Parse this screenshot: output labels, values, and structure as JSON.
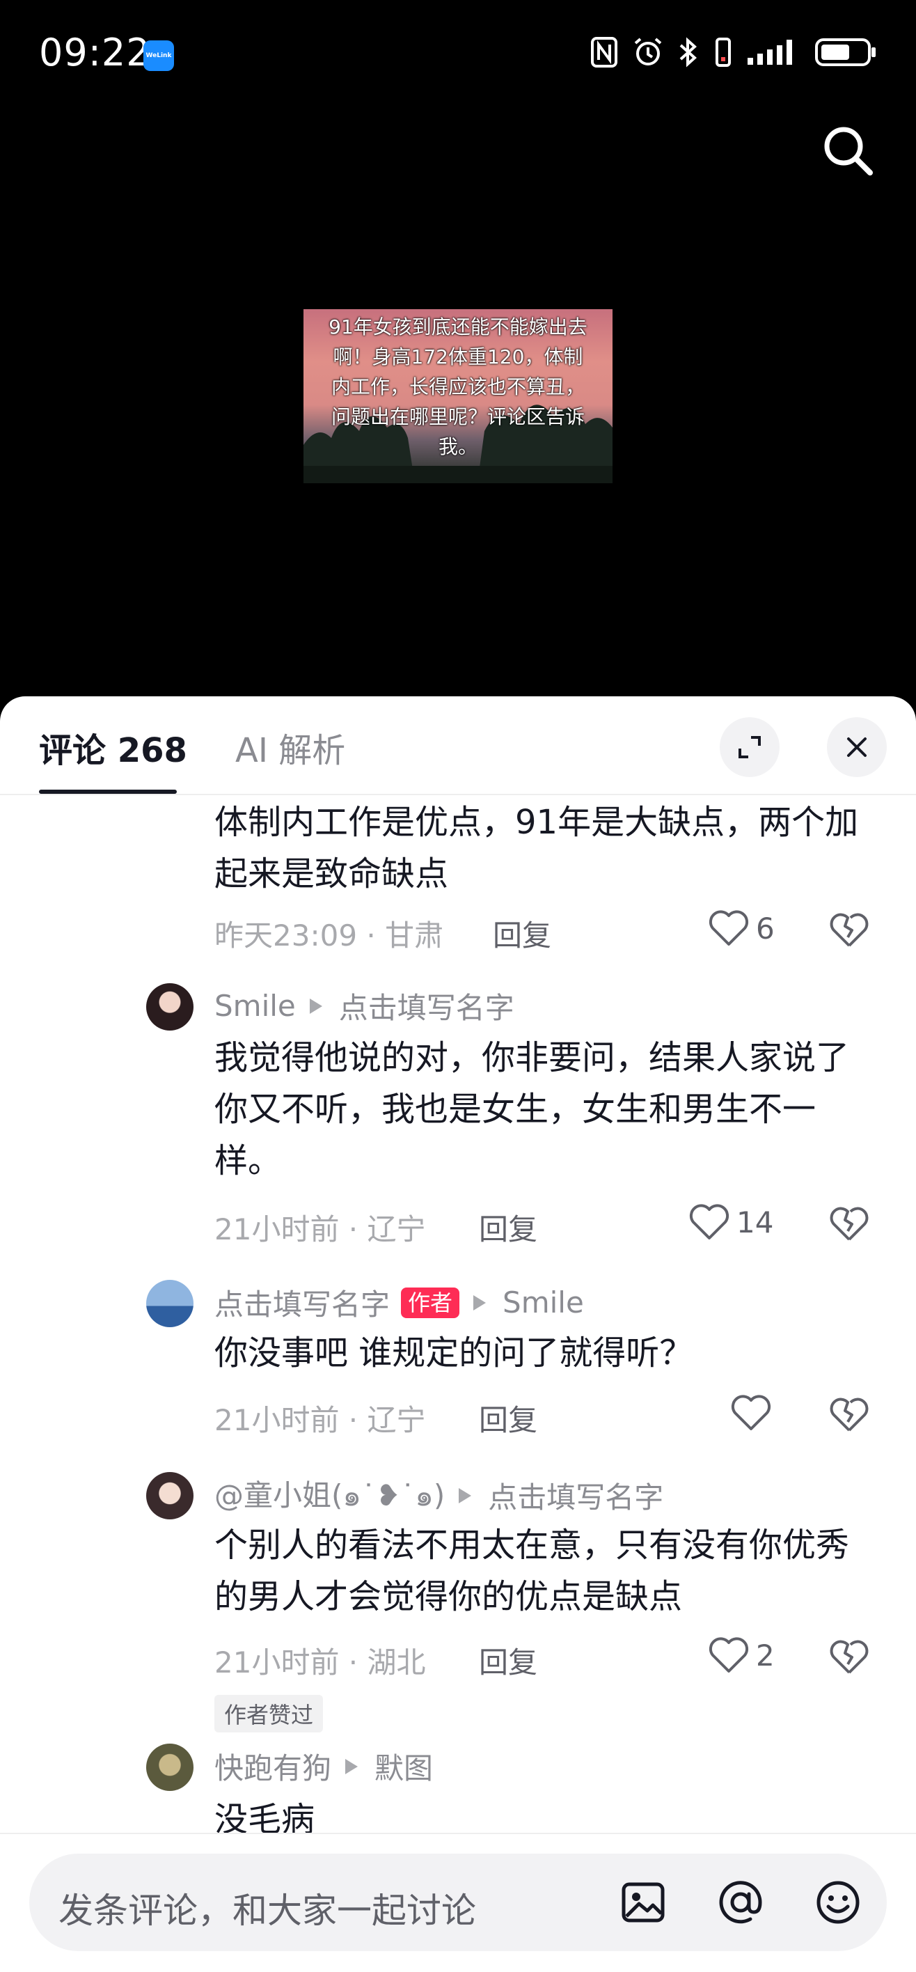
{
  "status_bar": {
    "time": "09:22",
    "app_badge": "WeLink"
  },
  "video": {
    "caption": "91年女孩到底还能不能嫁出去啊！身高172体重120，体制内工作，长得应该也不算丑，问题出在哪里呢？评论区告诉我。"
  },
  "tabs": {
    "comments_label": "评论 268",
    "ai_label": "AI 解析"
  },
  "comments": [
    {
      "text": "体制内工作是优点，91年是大缺点，两个加起来是致命缺点",
      "meta": "昨天23:09 · 甘肃",
      "reply": "回复",
      "likes": "6"
    },
    {
      "user": "Smile",
      "reply_to": "点击填写名字",
      "text": "我觉得他说的对，你非要问，结果人家说了你又不听，我也是女生，女生和男生不一样。",
      "meta": "21小时前 · 辽宁",
      "reply": "回复",
      "likes": "14"
    },
    {
      "user": "点击填写名字",
      "author_tag": "作者",
      "reply_to": "Smile",
      "text": "你没事吧 谁规定的问了就得听？",
      "meta": "21小时前 · 辽宁",
      "reply": "回复",
      "likes": ""
    },
    {
      "user": "@童小姐(๑˙❥˙๑)",
      "reply_to": "点击填写名字",
      "text": "个别人的看法不用太在意，只有没有你优秀的男人才会觉得你的优点是缺点",
      "meta": "21小时前 · 湖北",
      "reply": "回复",
      "likes": "2",
      "liked_tag": "作者赞过"
    },
    {
      "user": "快跑有狗",
      "reply_to": "默图",
      "text": "没毛病"
    }
  ],
  "input": {
    "placeholder": "发条评论，和大家一起讨论"
  }
}
